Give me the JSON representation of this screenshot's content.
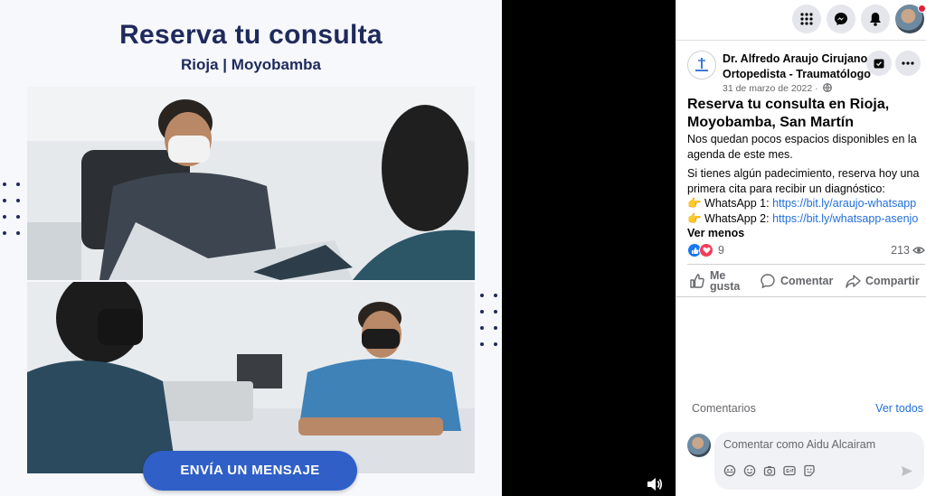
{
  "poster": {
    "title": "Reserva tu consulta",
    "subtitle": "Rioja | Moyobamba",
    "cta_label": "ENVÍA UN MENSAJE"
  },
  "topbar": {
    "icons": [
      "menu-grid-icon",
      "messenger-icon",
      "notifications-bell-icon",
      "profile-avatar"
    ]
  },
  "post": {
    "page_name": "Dr. Alfredo Araujo Cirujano Ortopedista - Traumatólogo",
    "date": "31 de marzo de 2022 ·",
    "title": "Reserva tu consulta en Rioja, Moyobamba, San Martín",
    "para1": "Nos quedan pocos espacios disponibles en la agenda de este mes.",
    "para2": "Si tienes algún padecimiento, reserva hoy una primera cita para recibir un diagnóstico:",
    "wa1_prefix": "👉 WhatsApp 1: ",
    "wa1_link": "https://bit.ly/araujo-whatsapp",
    "wa2_prefix": "👉 WhatsApp 2: ",
    "wa2_link": "https://bit.ly/whatsapp-asenjo",
    "see_less": "Ver menos",
    "reaction_count": "9",
    "views_count": "213"
  },
  "actions": {
    "like": "Me gusta",
    "comment": "Comentar",
    "share": "Compartir"
  },
  "comments": {
    "label": "Comentarios",
    "see_all": "Ver todos",
    "placeholder": "Comentar como Aidu Alcairam"
  },
  "colors": {
    "brand_blue": "#1877f2",
    "link_blue": "#216fdb",
    "poster_navy": "#1f2a5c",
    "cta_blue": "#2f5fc7"
  }
}
